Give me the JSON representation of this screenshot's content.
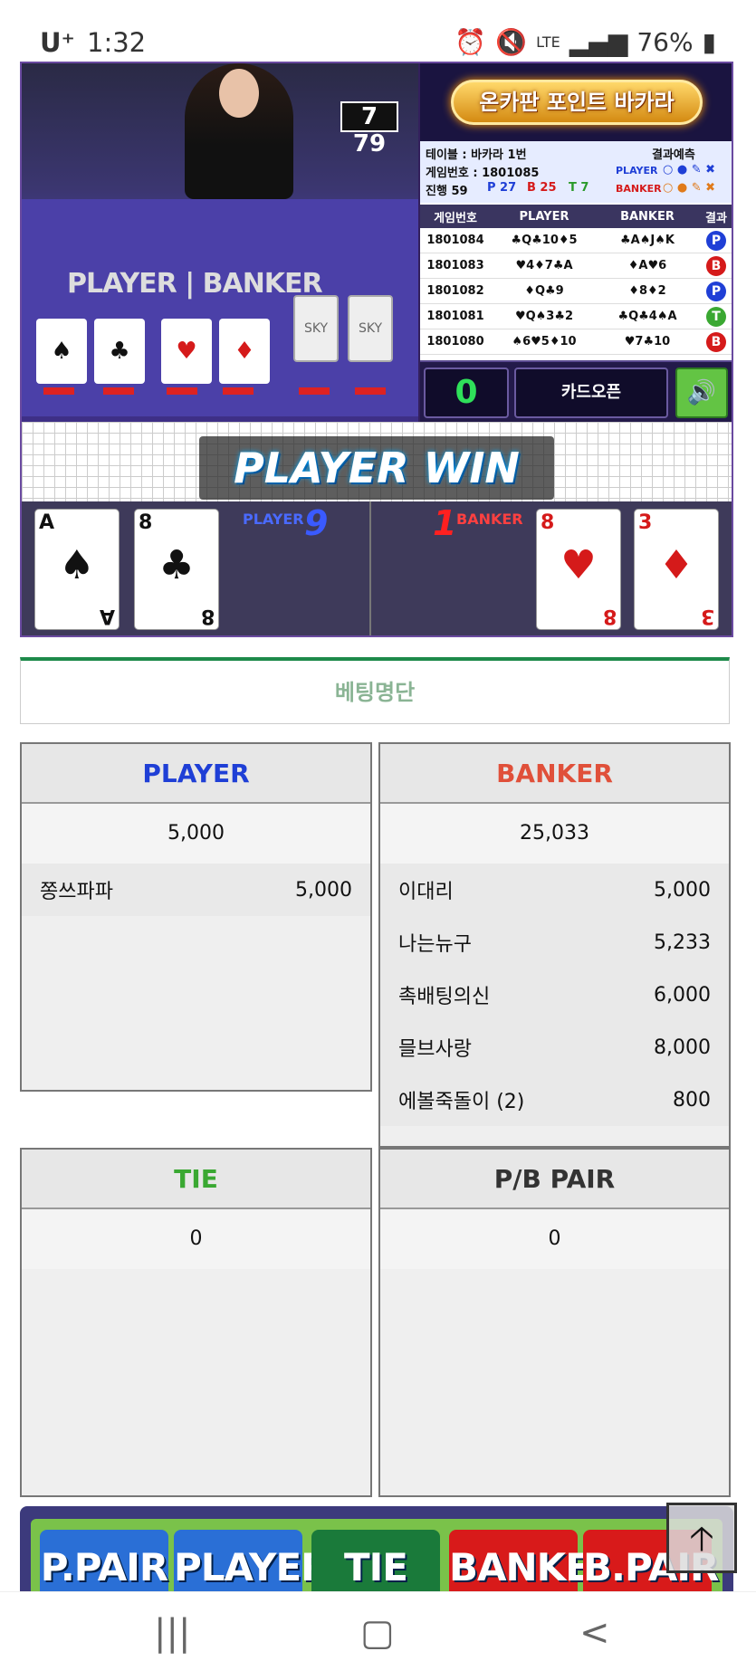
{
  "status_bar": {
    "carrier": "U⁺",
    "time": "1:32",
    "battery": "76%",
    "icons": [
      "alarm-icon",
      "mute-icon",
      "lte-icon",
      "signal-icon",
      "battery-icon"
    ]
  },
  "stream": {
    "timer": "7 79",
    "board_label": "PLAYER | BANKER",
    "back_card_label": "SKY"
  },
  "panel": {
    "banner_title": "온카판 포인트 바카라",
    "table_label": "테이블 : 바카라 1번",
    "prediction_label": "결과예측",
    "game_no_label": "게임번호 : 1801085",
    "progress_label": "진행 59",
    "p_count": "P 27",
    "b_count": "B 25",
    "t_count": "T 7",
    "player_tag": "PLAYER",
    "banker_tag": "BANKER",
    "history_headers": [
      "게임번호",
      "PLAYER",
      "BANKER",
      "결과"
    ],
    "history": [
      {
        "no": "1801084",
        "player": "♣Q♣10♦5",
        "banker": "♣A♠J♠K",
        "result": "P"
      },
      {
        "no": "1801083",
        "player": "♥4♦7♣A",
        "banker": "♦A♥6",
        "result": "B"
      },
      {
        "no": "1801082",
        "player": "♦Q♣9",
        "banker": "♦8♦2",
        "result": "P"
      },
      {
        "no": "1801081",
        "player": "♥Q♠3♣2",
        "banker": "♣Q♣4♠A",
        "result": "T"
      },
      {
        "no": "1801080",
        "player": "♠6♥5♦10",
        "banker": "♥7♣10",
        "result": "B"
      }
    ],
    "count": "0",
    "card_open": "카드오픈"
  },
  "result_banner": "PLAYER WIN",
  "hand": {
    "player_label": "PLAYER",
    "player_score": "9",
    "banker_score": "1",
    "banker_label": "BANKER",
    "player_cards": [
      {
        "rank": "A",
        "suit": "♠"
      },
      {
        "rank": "8",
        "suit": "♣"
      }
    ],
    "banker_cards": [
      {
        "rank": "8",
        "suit": "♥"
      },
      {
        "rank": "3",
        "suit": "♦"
      }
    ]
  },
  "betting_list_title": "베팅명단",
  "bets": {
    "player": {
      "title": "PLAYER",
      "total": "5,000",
      "entries": [
        {
          "name": "쫑쓰파파",
          "amount": "5,000"
        }
      ]
    },
    "banker": {
      "title": "BANKER",
      "total": "25,033",
      "entries": [
        {
          "name": "이대리",
          "amount": "5,000"
        },
        {
          "name": "나는뉴구",
          "amount": "5,233"
        },
        {
          "name": "촉배팅의신",
          "amount": "6,000"
        },
        {
          "name": "믈브사랑",
          "amount": "8,000"
        },
        {
          "name": "에볼죽돌이 (2)",
          "amount": "800"
        }
      ]
    },
    "tie": {
      "title": "TIE",
      "total": "0"
    },
    "pair": {
      "title": "P/B PAIR",
      "total": "0"
    }
  },
  "bet_buttons": [
    "P.PAIR",
    "PLAYER",
    "TIE",
    "BANKER",
    "B.PAIR"
  ],
  "colors": {
    "player": "#1f3fd6",
    "banker": "#e0503a",
    "tie": "#3aa832",
    "pair": "#333333"
  }
}
